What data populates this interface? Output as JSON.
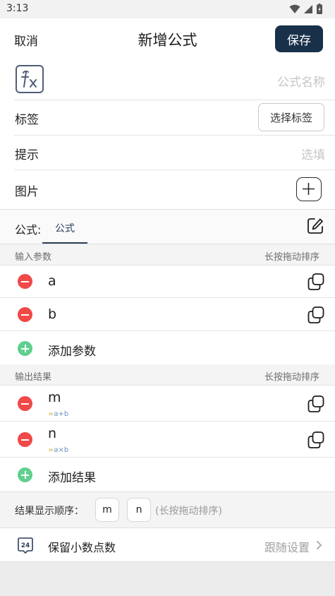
{
  "status_bar": {
    "time": "3:13"
  },
  "app_bar": {
    "cancel_label": "取消",
    "title": "新增公式",
    "save_label": "保存"
  },
  "form": {
    "name_placeholder": "公式名称",
    "tag_label": "标签",
    "tag_button": "选择标签",
    "hint_label": "提示",
    "hint_placeholder": "选填",
    "image_label": "图片"
  },
  "formula_tabs": {
    "prefix": "公式:",
    "tabs": [
      {
        "label": "公式",
        "active": true
      }
    ]
  },
  "inputs": {
    "section_title": "输入参数",
    "sort_note": "长按拖动排序",
    "params": [
      {
        "name": "a"
      },
      {
        "name": "b"
      }
    ],
    "add_label": "添加参数"
  },
  "outputs": {
    "section_title": "输出结果",
    "sort_note": "长按拖动排序",
    "results": [
      {
        "name": "m",
        "eq": "=",
        "expression": "a+b"
      },
      {
        "name": "n",
        "eq": "=",
        "expression": "a×b"
      }
    ],
    "add_label": "添加结果"
  },
  "result_order": {
    "label": "结果显示顺序：",
    "chips": [
      "m",
      "n"
    ],
    "hint": "(长按拖动排序)"
  },
  "decimal": {
    "icon_text": "24",
    "label": "保留小数点数",
    "value": "跟随设置"
  },
  "colors": {
    "accent": "#18304a",
    "remove": "#f14848",
    "add": "#5fd08e"
  }
}
